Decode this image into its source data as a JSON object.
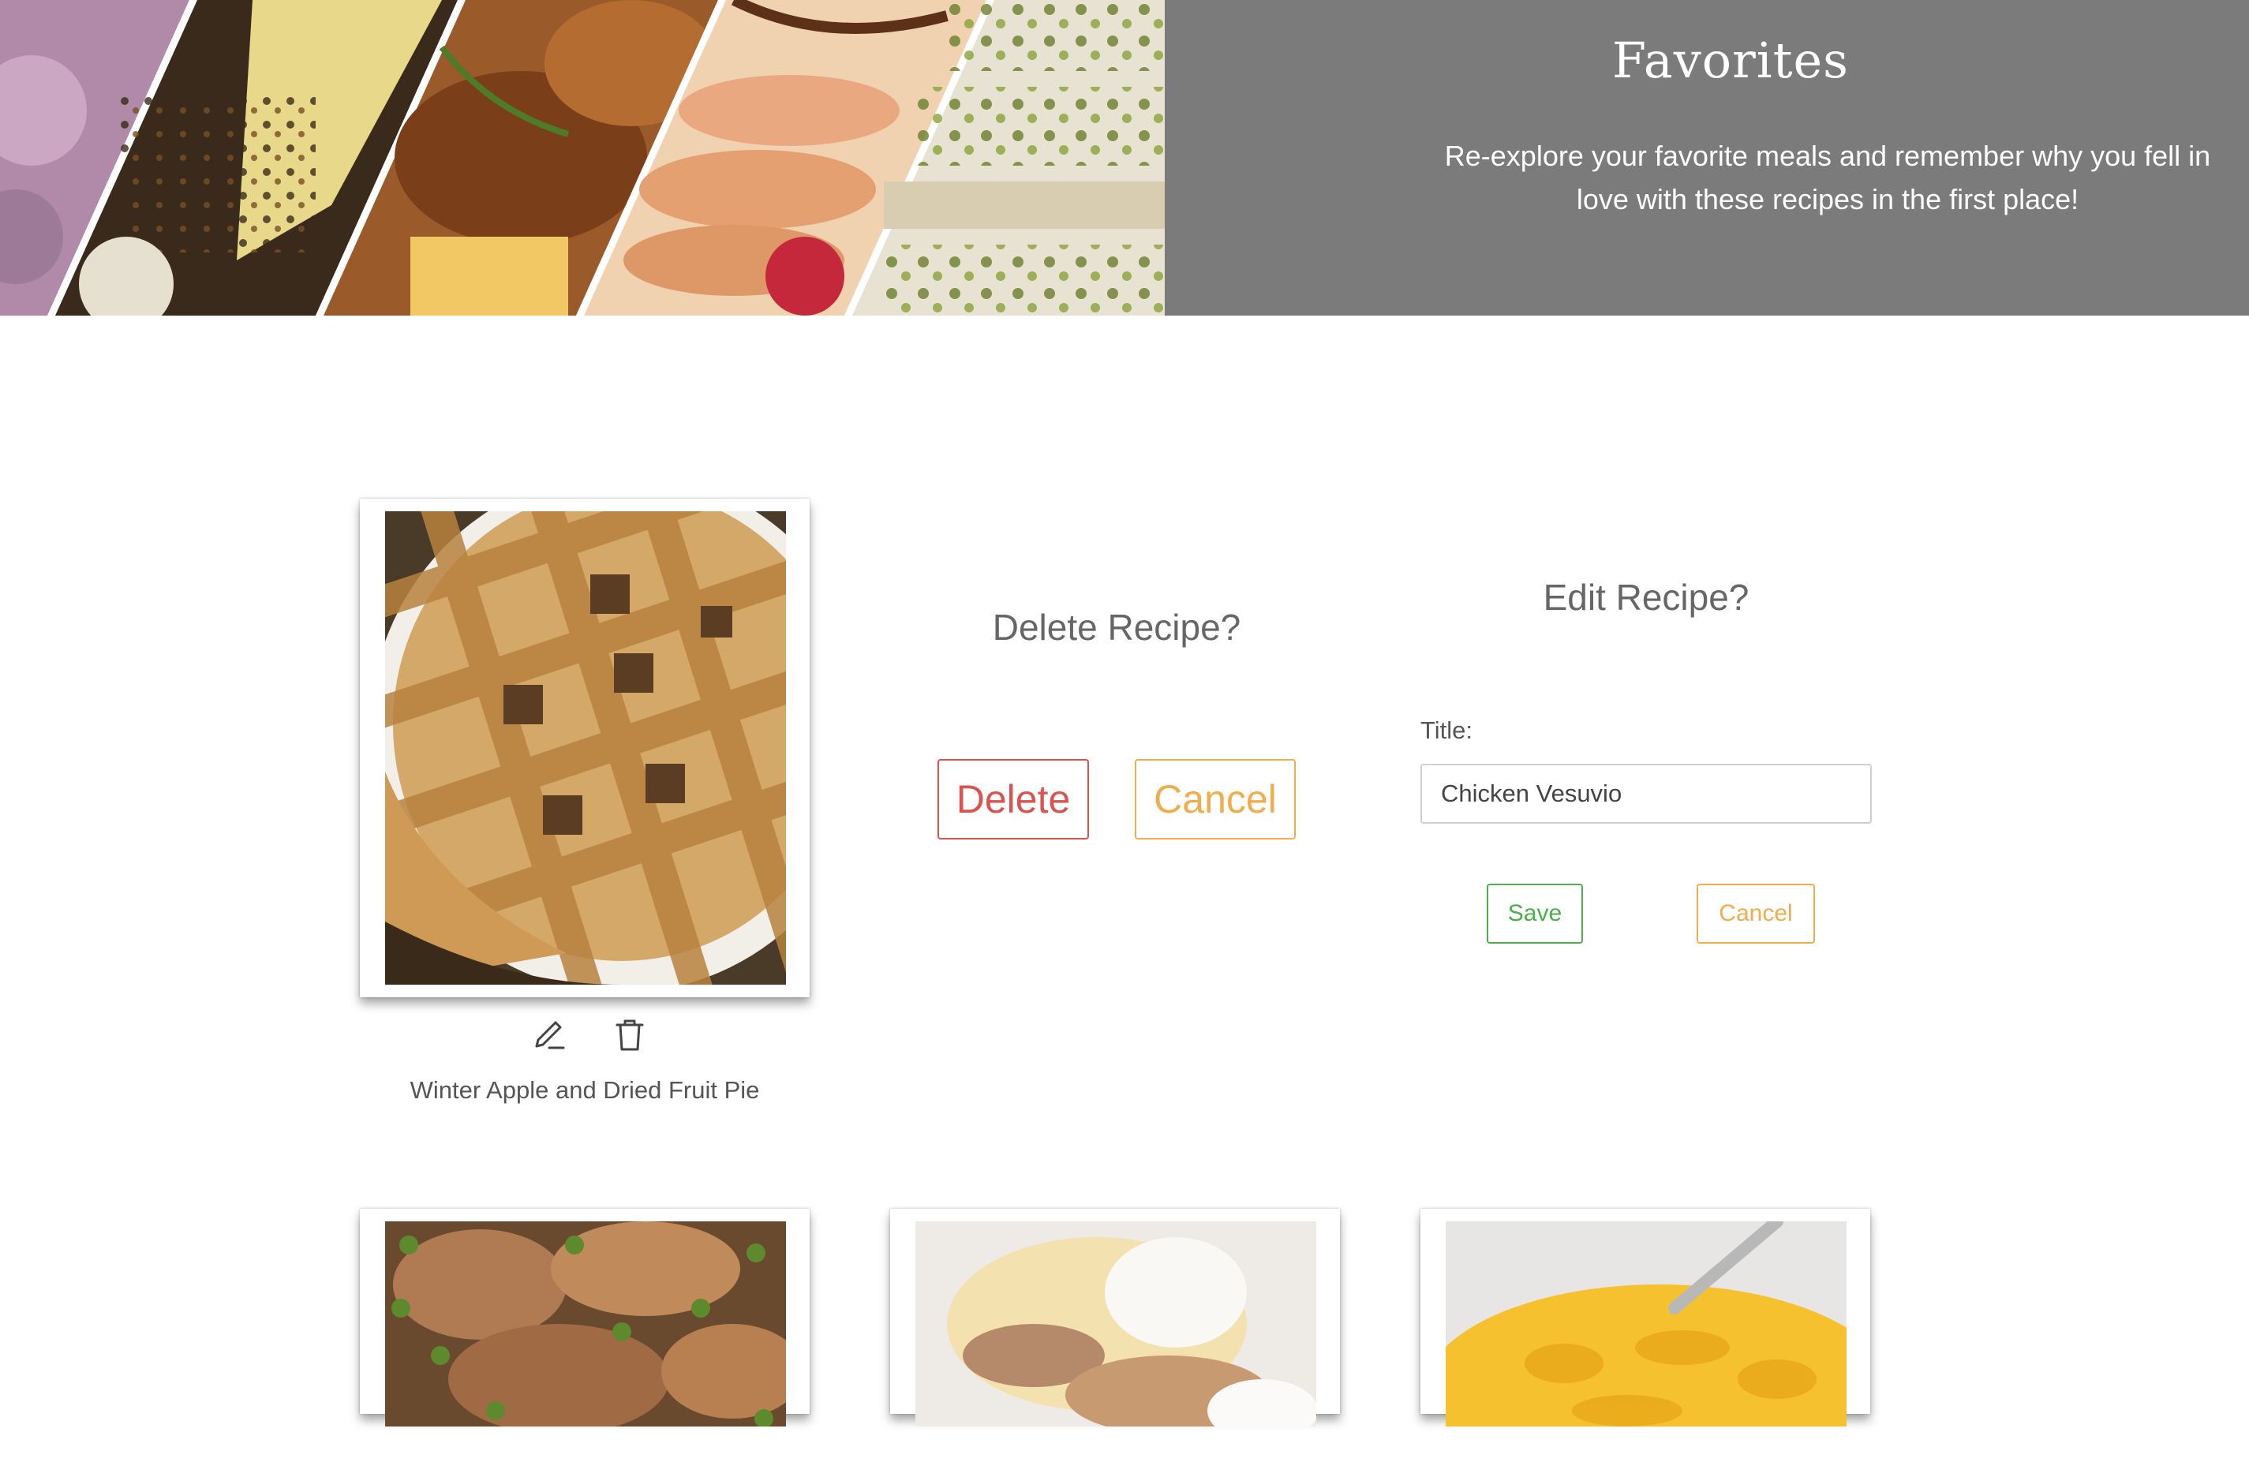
{
  "header": {
    "title": "Favorites",
    "subtitle": "Re-explore your favorite meals and remember why you fell in love with these recipes in the first place!",
    "background_color": "#7b7b7b"
  },
  "featured_recipe": {
    "title": "Winter Apple and Dried Fruit Pie",
    "image_alt": "lattice pie",
    "edit_icon": "pencil-icon",
    "delete_icon": "trash-icon"
  },
  "delete_panel": {
    "title": "Delete Recipe?",
    "delete_label": "Delete",
    "cancel_label": "Cancel"
  },
  "edit_panel": {
    "title": "Edit Recipe?",
    "field_label": "Title:",
    "field_value": "Chicken Vesuvio",
    "save_label": "Save",
    "cancel_label": "Cancel"
  },
  "colors": {
    "danger": "#d9534f",
    "warning": "#f0ad4e",
    "success": "#4cae4c"
  }
}
